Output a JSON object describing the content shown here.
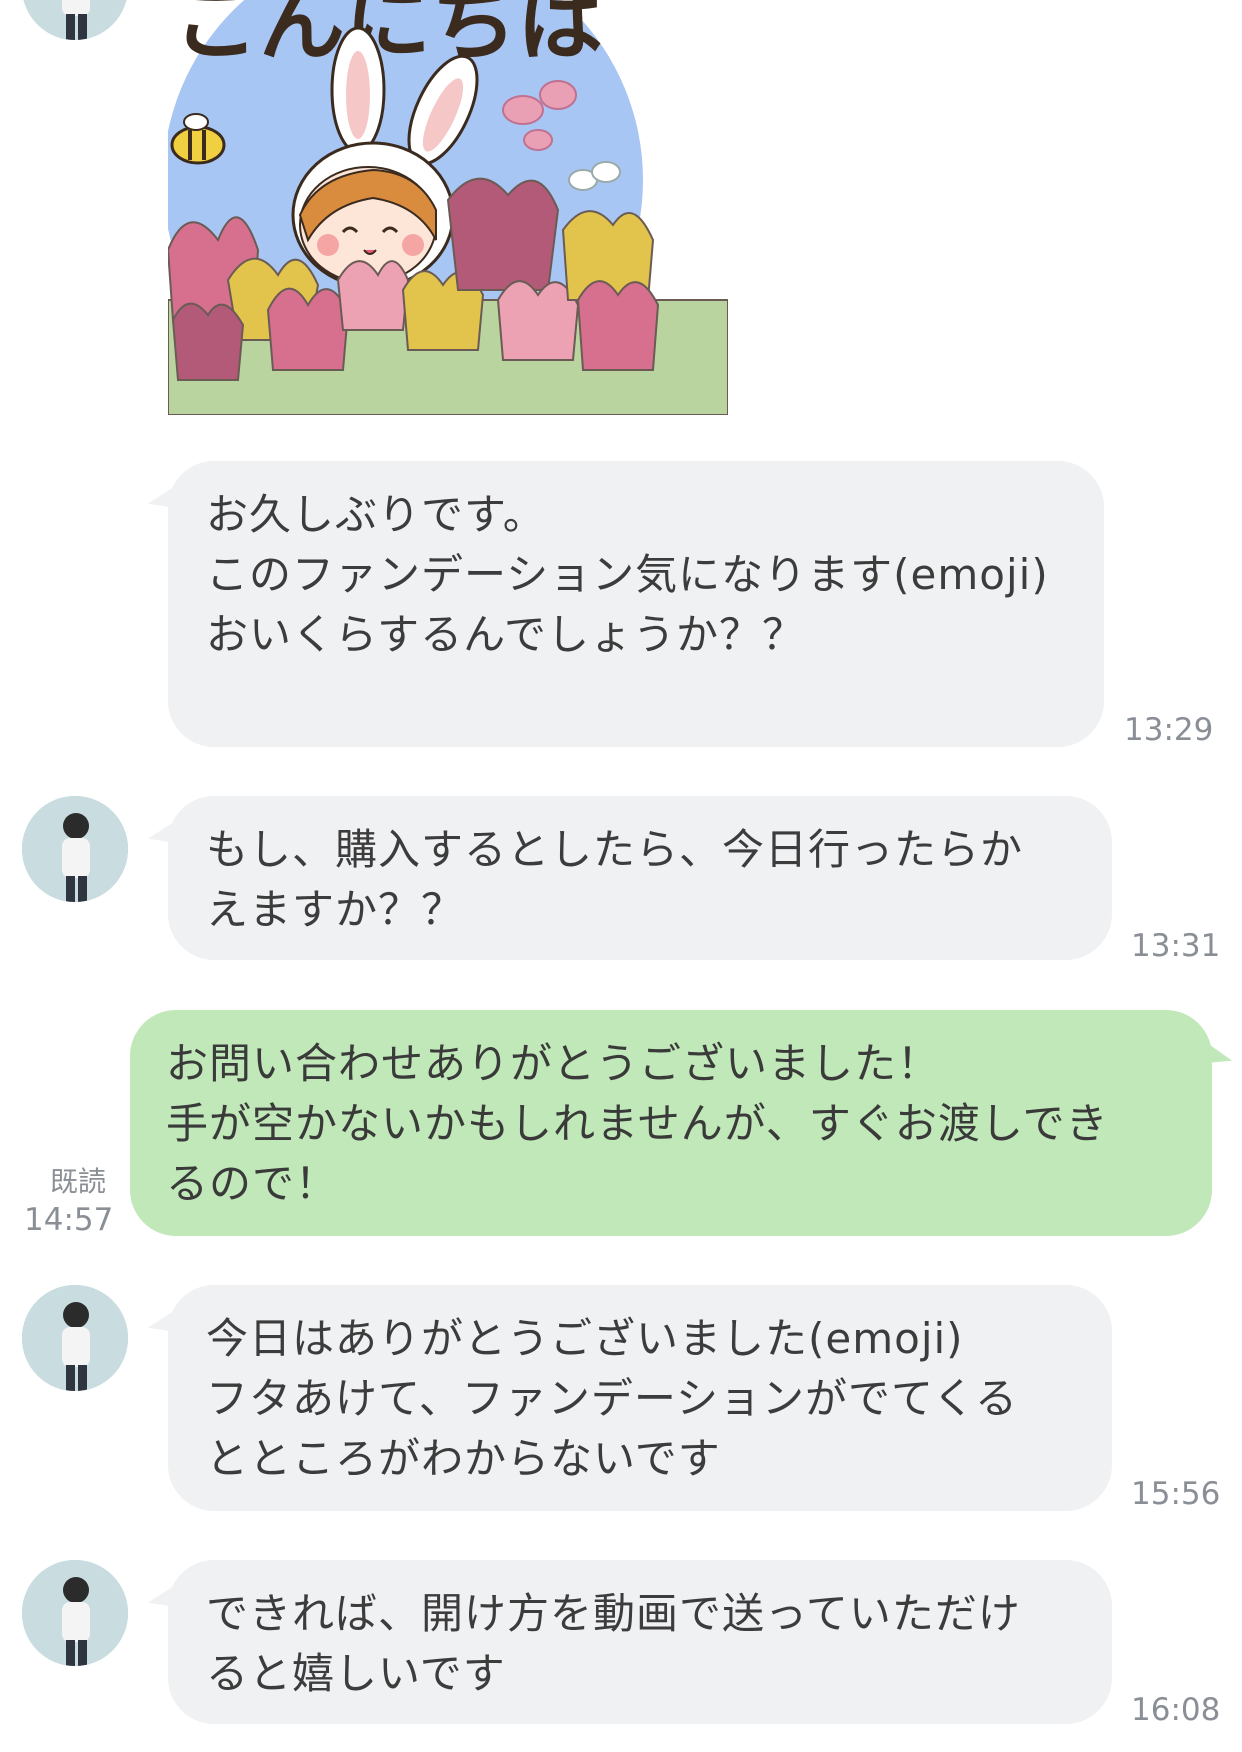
{
  "sticker": {
    "text": "こんにちは"
  },
  "messages": [
    {
      "side": "incoming",
      "text": "お久しぶりです。\nこのファンデーション気になります(emoji)\nおいくらするんでしょうか？？",
      "time": "13:29"
    },
    {
      "side": "incoming",
      "text": "もし、購入するとしたら、今日行ったらか\nえますか？？",
      "time": "13:31"
    },
    {
      "side": "outgoing",
      "text": "お問い合わせありがとうございました！\n手が空かないかもしれませんが、すぐお渡しでき\nるので！",
      "read": "既読",
      "time": "14:57"
    },
    {
      "side": "incoming",
      "text": "今日はありがとうございました(emoji)\nフタあけて、ファンデーションがでてくる\nとところがわからないです",
      "time": "15:56"
    },
    {
      "side": "incoming",
      "text": "できれば、開け方を動画で送っていただけ\nると嬉しいです",
      "time": "16:08"
    }
  ],
  "colors": {
    "incoming_bubble": "#f0f1f3",
    "outgoing_bubble": "#c1e8b9",
    "meta_text": "#8a8f96"
  },
  "icons": [
    "avatar",
    "sticker-bunny-girl"
  ]
}
